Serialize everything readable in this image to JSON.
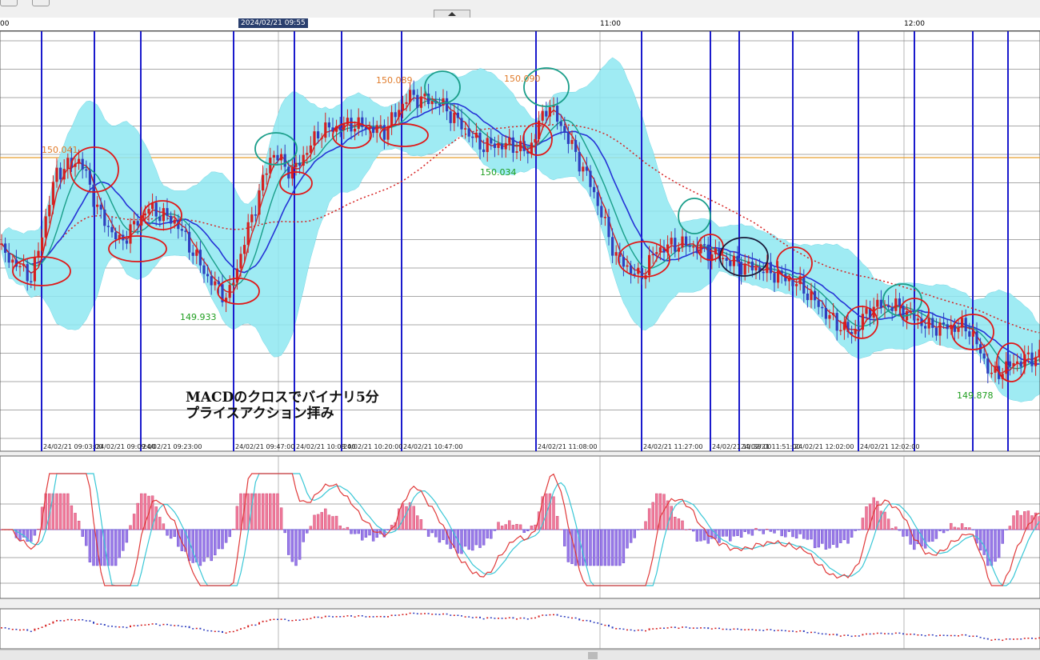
{
  "time_axis": {
    "cursor_time": "2024/02/21 09:55",
    "labels": [
      {
        "text": "00"
      },
      {
        "text": "11:00"
      },
      {
        "text": "12:00"
      }
    ]
  },
  "chart_data": {
    "type": "candlestick",
    "symbol_note": "",
    "price_labels": [
      {
        "text": "150.041",
        "color": "#e07b2a"
      },
      {
        "text": "150.089",
        "color": "#e07b2a"
      },
      {
        "text": "150.090",
        "color": "#e07b2a"
      },
      {
        "text": "150.034",
        "color": "#1f9e1f"
      },
      {
        "text": "149.933",
        "color": "#1f9e1f"
      },
      {
        "text": "149.878",
        "color": "#1f9e1f"
      }
    ],
    "horizontal_line": {
      "price": 150.041,
      "color": "#e8a030"
    },
    "annotation": {
      "line1": "MACDのクロスでバイナリ5分",
      "line2": "プライスアクション拝み"
    },
    "vline_labels": [
      "24/02/21 09:03:00",
      "24/02/21 09:09:00",
      "24/02/21 09:23:00",
      "24/02/21 09:47:00",
      "24/02/21 10:08:00",
      "24/02/21 10:20:00",
      "24/02/21 10:47:00",
      "24/02/21 11:08:00",
      "24/02/21 11:27:00",
      "24/02/21 11:38:00",
      "24/02/21 11:51:00",
      "24/02/21 12:02:00",
      "24/02/21 12:02:00"
    ],
    "colors": {
      "bull": "#d62020",
      "bear": "#2f3fbf",
      "band": "#8fe8f2",
      "vline": "#1a1acc",
      "ma_red": "#d62020",
      "ma_teal": "#1a9e8a",
      "ma_blue": "#2533d6",
      "macd_pos": "#f07a9a",
      "macd_neg": "#9a7ae8",
      "macd_line": "#e03a3a",
      "signal_line": "#39c7d6"
    },
    "macd_panel": {
      "zero_line": 0
    },
    "circle_colors": [
      "red",
      "teal",
      "black"
    ]
  }
}
